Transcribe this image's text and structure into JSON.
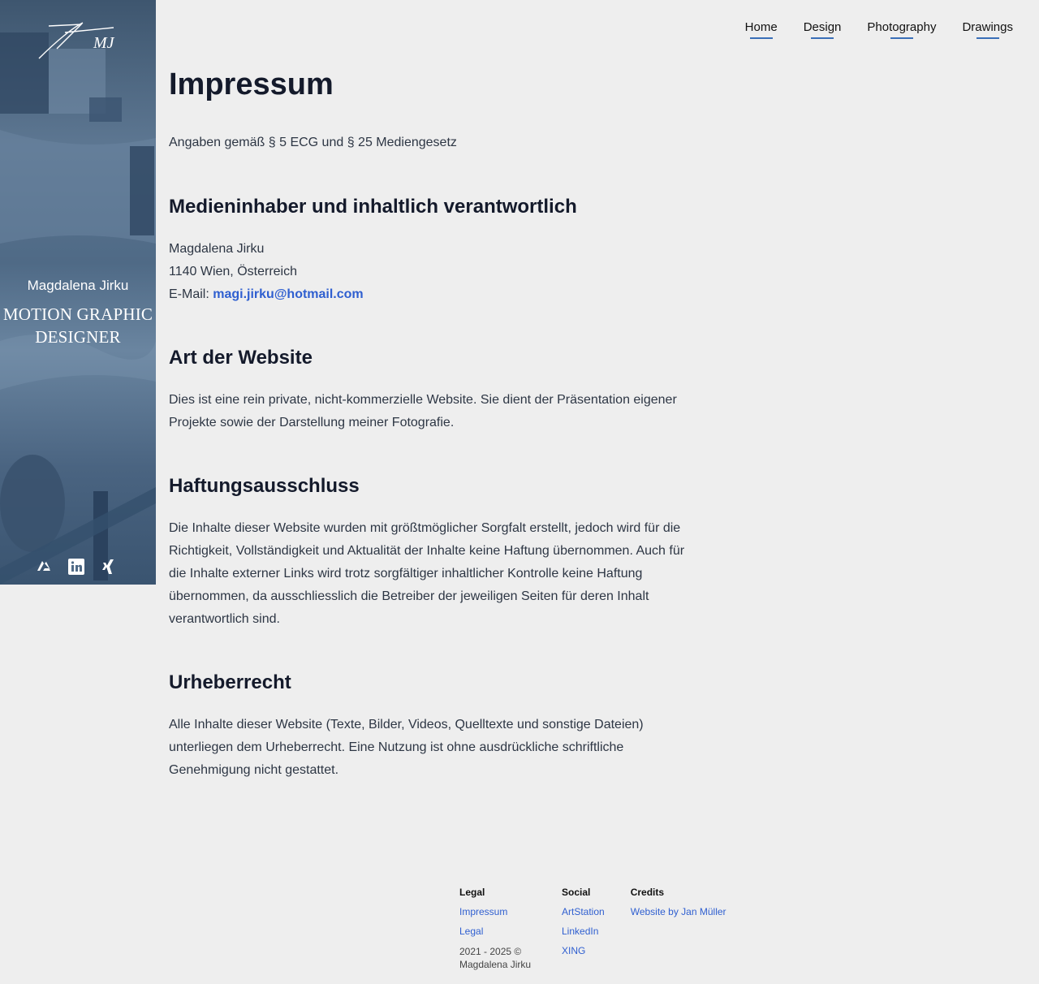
{
  "sidebar": {
    "logo_text": "MJ",
    "name": "Magdalena Jirku",
    "title_line1": "MOTION GRAPHIC",
    "title_line2": "DESIGNER",
    "social_icons": [
      "artstation-icon",
      "linkedin-icon",
      "xing-icon"
    ]
  },
  "nav": {
    "items": [
      {
        "label": "Home"
      },
      {
        "label": "Design"
      },
      {
        "label": "Photography"
      },
      {
        "label": "Drawings"
      }
    ]
  },
  "main": {
    "title": "Impressum",
    "lead": "Angaben gemäß § 5 ECG und § 25 Mediengesetz",
    "sections": [
      {
        "heading": "Medieninhaber und inhaltlich verantwortlich",
        "lines": [
          "Magdalena Jirku",
          "1140 Wien, Österreich"
        ],
        "email_label": "E-Mail:",
        "email": "magi.jirku@hotmail.com"
      },
      {
        "heading": "Art der Website",
        "text": "Dies ist eine rein private, nicht-kommerzielle Website. Sie dient der Präsentation eigener Projekte sowie der Darstellung meiner Fotografie."
      },
      {
        "heading": "Haftungsausschluss",
        "text": "Die Inhalte dieser Website wurden mit größtmöglicher Sorgfalt erstellt, jedoch wird für die Richtigkeit, Vollständigkeit und Aktualität der Inhalte keine Haftung übernommen. Auch für die Inhalte externer Links wird trotz sorgfältiger inhaltlicher Kontrolle keine Haftung übernommen, da ausschliesslich die Betreiber der jeweiligen Seiten für deren Inhalt verantwortlich sind."
      },
      {
        "heading": "Urheberrecht",
        "text": "Alle Inhalte dieser Website (Texte, Bilder, Videos, Quelltexte und sonstige Dateien) unterliegen dem Urheberrecht. Eine Nutzung ist ohne ausdrückliche schriftliche Genehmigung nicht gestattet."
      }
    ]
  },
  "footer": {
    "legal": {
      "heading": "Legal",
      "links": [
        "Impressum",
        "Legal"
      ],
      "copyright": "2021 - 2025 © Magdalena Jirku"
    },
    "social": {
      "heading": "Social",
      "links": [
        "ArtStation",
        "LinkedIn",
        "XING"
      ]
    },
    "credits": {
      "heading": "Credits",
      "links": [
        "Website by Jan Müller"
      ]
    }
  },
  "colors": {
    "accent": "#2f5fd0",
    "nav_underline": "#3a6fb8",
    "sidebar": "#4f6a86",
    "background": "#eeeeee"
  }
}
